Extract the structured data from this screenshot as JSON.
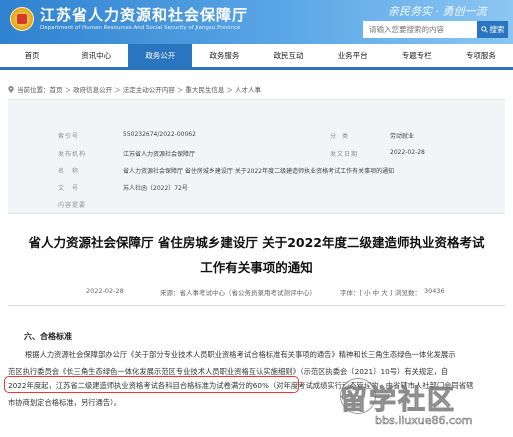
{
  "header": {
    "site_title": "江苏省人力资源和社会保障厅",
    "site_subtitle": "Department of Human Resources And Social Security of Jiangsu Province",
    "slogan": "亲民务实 · 勇创一流",
    "search_placeholder": "请输入您要搜索的内容",
    "search_button": "搜索"
  },
  "nav": {
    "items": [
      "首页",
      "资讯中心",
      "政务公开",
      "政务服务",
      "政民互动",
      "业务平台",
      "专题专栏",
      "专项服务"
    ],
    "active_index": 2
  },
  "breadcrumb": "当前位置：首页 ＞ 政府信息公开 ＞ 法定主动公开内容 ＞ 重大民生信息 ＞ 人才人事",
  "info": {
    "rows": [
      {
        "label": "索引号",
        "value": "550232674/2022-00062",
        "label2": "分类",
        "value2": "劳动就业"
      },
      {
        "label": "发布机构",
        "value": "江苏省人力资源社会保障厅",
        "label2": "发文日期",
        "value2": "2022-02-28"
      },
      {
        "label": "名称",
        "value": "省人力资源社会保障厅 省住房城乡建设厅 关于2022年度二级建造师执业资格考试工作有关事项的通知",
        "label2": "",
        "value2": ""
      },
      {
        "label": "文号",
        "value": "苏人社函〔2022〕72号",
        "label2": "",
        "value2": ""
      },
      {
        "label": "内容提要",
        "value": "",
        "label2": "",
        "value2": ""
      }
    ]
  },
  "doc": {
    "title_line1": "省人力资源社会保障厅 省住房城乡建设厅 关于2022年度二级建造师执业资格考试",
    "title_line2": "工作有关事项的通知",
    "meta_date": "2022-02-28",
    "meta_source": "来源：省人事考试中心（省公务员录用考试测评中心）",
    "meta_font": "字体：[ 小 中 大 ]",
    "meta_views_label": "浏览数：",
    "meta_views": "30436"
  },
  "body": {
    "section_head": "六、合格标准",
    "lines": [
      "根据人力资源社会保障部办公厅《关于部分专业技术人员职业资格考试合格标准有关事项的通告》精神和长三角生态绿色一体化发展示",
      "范区执行委员会《长三角生态绿色一体化发展示范区专业技术人员职业资格互认实施细则》（示范区执委会〔2021〕10号）有关规定，自",
      "2022年度起，江苏省二级建造师执业资格考试各科目合格标准为试卷满分的60%（对年度考试成绩实行动态管理的，由省辖市人社部门会同省辖",
      "市协商划定合格标准，另行通告）。"
    ]
  },
  "watermark": {
    "text": "留学社区",
    "url": "bbs.liuxue86.com"
  },
  "colors": {
    "brand_blue": "#2a74c0",
    "highlight_red": "#e33a35"
  }
}
